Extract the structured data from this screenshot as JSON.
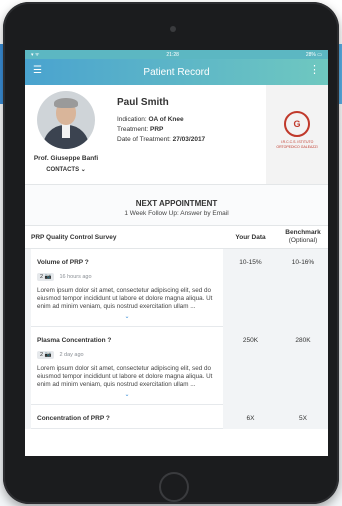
{
  "status_bar": {
    "left": "▾ ᯤ",
    "time": "21:28",
    "battery": "28% ▭"
  },
  "app_bar": {
    "title": "Patient Record",
    "menu_icon": "hamburger-icon",
    "more_icon": "more-vertical-icon"
  },
  "doctor": {
    "name": "Prof. Giuseppe Banfi",
    "contacts": "CONTACTS ⌄"
  },
  "patient": {
    "name": "Paul Smith",
    "indication_label": "Indication: ",
    "indication": "OA of Knee",
    "treatment_label": "Treatment: ",
    "treatment": "PRP",
    "date_label": "Date of Treatment: ",
    "date": "27/03/2017"
  },
  "institute": {
    "mark": "G",
    "text": "I.R.C.C.S. ISTITUTO ORTOPEDICO GALEAZZI"
  },
  "appointment": {
    "heading": "NEXT APPOINTMENT",
    "detail": "1 Week Follow Up: Answer by Email"
  },
  "table": {
    "col_survey": "PRP Quality Control Survey",
    "col_your_data": "Your Data",
    "col_benchmark": "Benchmark",
    "col_benchmark_note": "(Optional)",
    "rows": [
      {
        "title": "Volume of PRP ?",
        "badge": "2 📷",
        "time": "16 hours ago",
        "body": "Lorem ipsum dolor sit amet, consectetur adipiscing elit, sed do eiusmod tempor incididunt ut labore et dolore magna aliqua. Ut enim ad minim veniam, quis nostrud exercitation ullam ...",
        "your_data": "10-15%",
        "benchmark": "10-16%"
      },
      {
        "title": "Plasma Concentration ?",
        "badge": "2 📷",
        "time": "2 day ago",
        "body": "Lorem ipsum dolor sit amet, consectetur adipiscing elit, sed do eiusmod tempor incididunt ut labore et dolore magna aliqua. Ut enim ad minim veniam, quis nostrud exercitation ullam ...",
        "your_data": "250K",
        "benchmark": "280K"
      },
      {
        "title": "Concentration of PRP ?",
        "your_data": "6X",
        "benchmark": "5X"
      }
    ]
  }
}
